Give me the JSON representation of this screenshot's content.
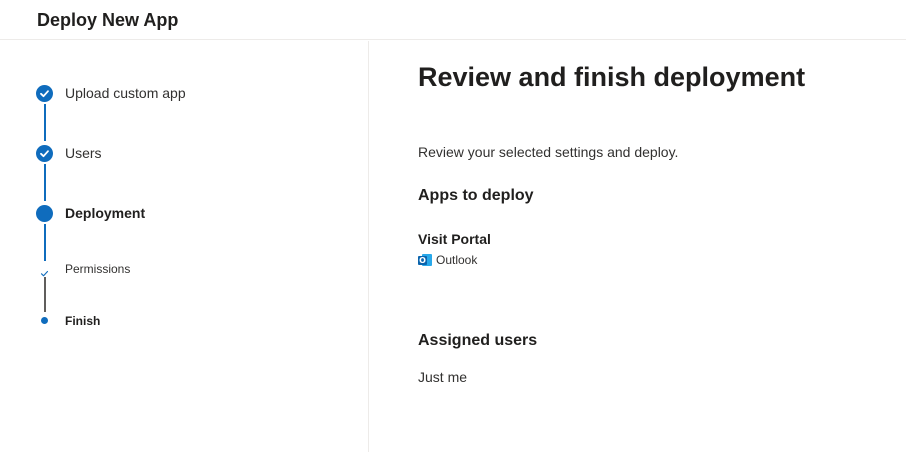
{
  "header": {
    "title": "Deploy New App"
  },
  "steps": [
    {
      "label": "Upload custom app",
      "state": "completed"
    },
    {
      "label": "Users",
      "state": "completed"
    },
    {
      "label": "Deployment",
      "state": "current"
    },
    {
      "label": "Permissions",
      "state": "completed-substep"
    },
    {
      "label": "Finish",
      "state": "current-substep"
    }
  ],
  "main": {
    "title": "Review and finish deployment",
    "intro": "Review your selected settings and deploy.",
    "apps_section": {
      "heading": "Apps to deploy",
      "apps": [
        {
          "name": "Visit Portal",
          "host": "Outlook",
          "icon": "outlook-icon"
        }
      ]
    },
    "users_section": {
      "heading": "Assigned users",
      "value": "Just me"
    }
  },
  "colors": {
    "accent": "#0f6cbd",
    "text": "#201f1e",
    "divider": "#edebe9",
    "connector_inactive": "#605e5c"
  }
}
